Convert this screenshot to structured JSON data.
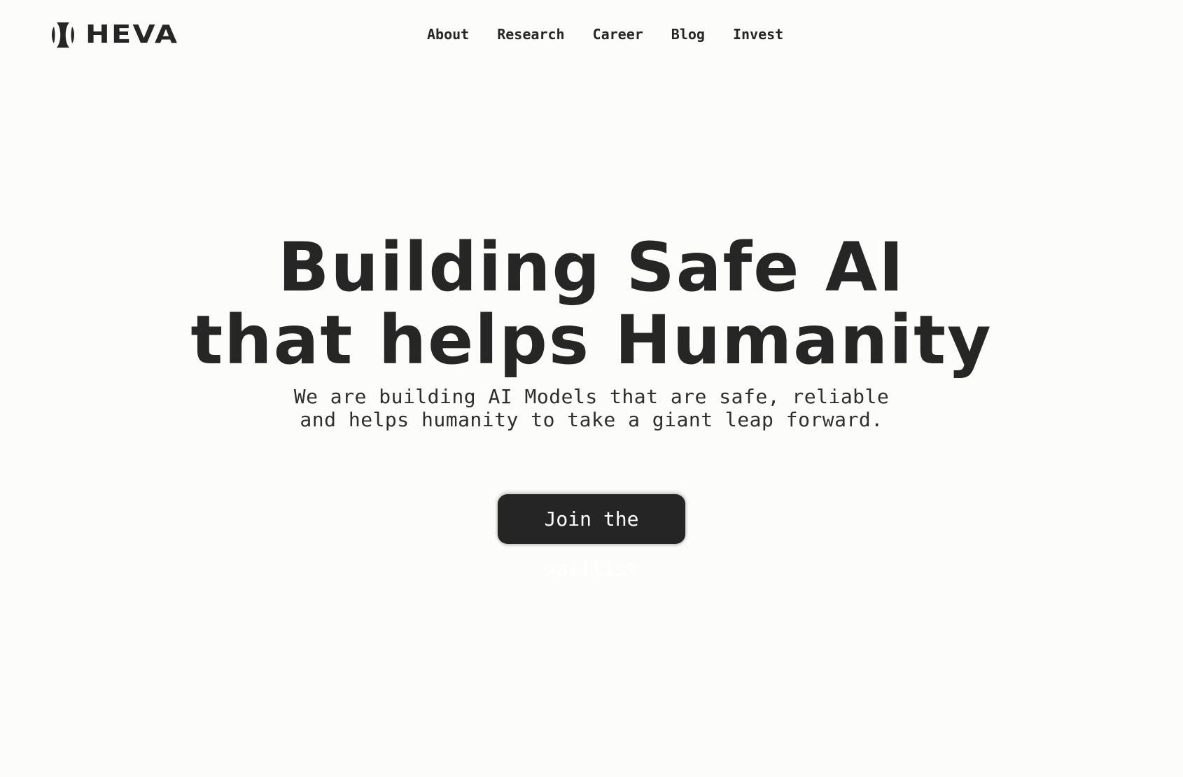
{
  "header": {
    "brand": "HEVA",
    "nav": [
      "About",
      "Research",
      "Career",
      "Blog",
      "Invest"
    ]
  },
  "hero": {
    "title_line1": "Building Safe AI",
    "title_line2": "that helps Humanity",
    "subtitle": "We are building AI Models that are safe, reliable and helps humanity to take a giant leap forward.",
    "cta_label": "Join the waitlist"
  },
  "colors": {
    "background": "#fcfdfa",
    "text": "#262626",
    "button": "#252525",
    "button_text": "#ffffff"
  },
  "icons": {
    "logo": "heva-logo-icon"
  }
}
